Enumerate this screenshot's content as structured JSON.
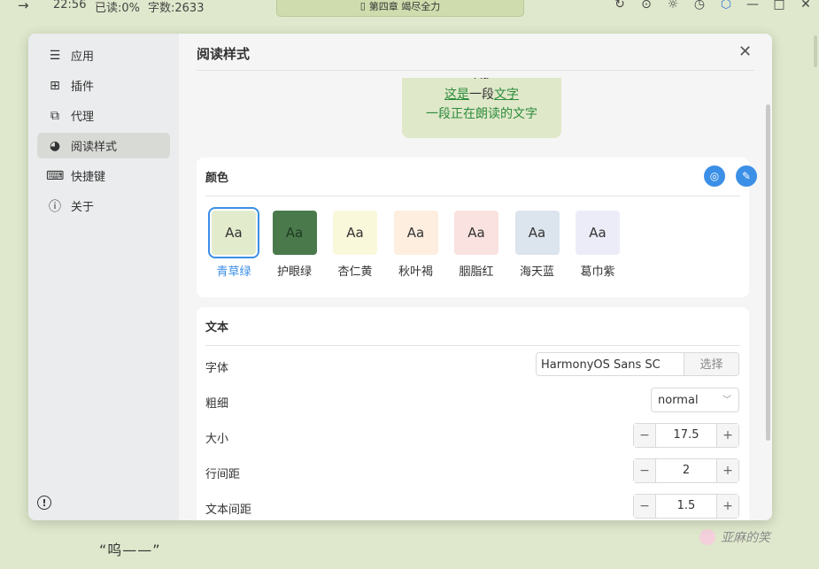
{
  "topbar": {
    "time": "22:56",
    "read_progress": "已读:0%",
    "word_count": "字数:2633",
    "chapter_title": "第四章 竭尽全力"
  },
  "background": {
    "text": "“呜——”",
    "watermark": "亚麻的笑"
  },
  "sidebar": {
    "items": [
      {
        "label": "应用",
        "icon": "sliders-icon"
      },
      {
        "label": "插件",
        "icon": "grid-icon"
      },
      {
        "label": "代理",
        "icon": "network-icon"
      },
      {
        "label": "阅读样式",
        "icon": "palette-icon"
      },
      {
        "label": "快捷键",
        "icon": "keyboard-icon"
      },
      {
        "label": "关于",
        "icon": "info-icon"
      }
    ],
    "active_index": 3
  },
  "main": {
    "title": "阅读样式",
    "preview": {
      "aa": "Aa",
      "line1_a": "这是",
      "line1_b": "一段",
      "line1_c": "文字",
      "line2": "一段正在朗读的文字"
    },
    "colors": {
      "title": "颜色",
      "themes": [
        {
          "label": "青草绿",
          "bg": "#e3ebcd",
          "fg": "#333333"
        },
        {
          "label": "护眼绿",
          "bg": "#4a7a4c",
          "fg": "#1f3a20"
        },
        {
          "label": "杏仁黄",
          "bg": "#faf8db",
          "fg": "#333333"
        },
        {
          "label": "秋叶褐",
          "bg": "#fdeee0",
          "fg": "#333333"
        },
        {
          "label": "胭脂红",
          "bg": "#f9e2df",
          "fg": "#333333"
        },
        {
          "label": "海天蓝",
          "bg": "#dce4ed",
          "fg": "#333333"
        },
        {
          "label": "葛巾紫",
          "bg": "#ececf9",
          "fg": "#333333"
        }
      ],
      "swatch_text": "Aa",
      "selected_index": 0
    },
    "text_section": {
      "title": "文本",
      "font_label": "字体",
      "font_value": "HarmonyOS Sans SC",
      "font_button": "选择",
      "weight_label": "粗细",
      "weight_value": "normal",
      "size_label": "大小",
      "size_value": "17.5",
      "line_height_label": "行间距",
      "line_height_value": "2",
      "letter_spacing_label": "文本间距",
      "letter_spacing_value": "1.5"
    }
  },
  "colors": {
    "accent": "#3b8fe6",
    "page_bg": "#dfe8cc"
  }
}
